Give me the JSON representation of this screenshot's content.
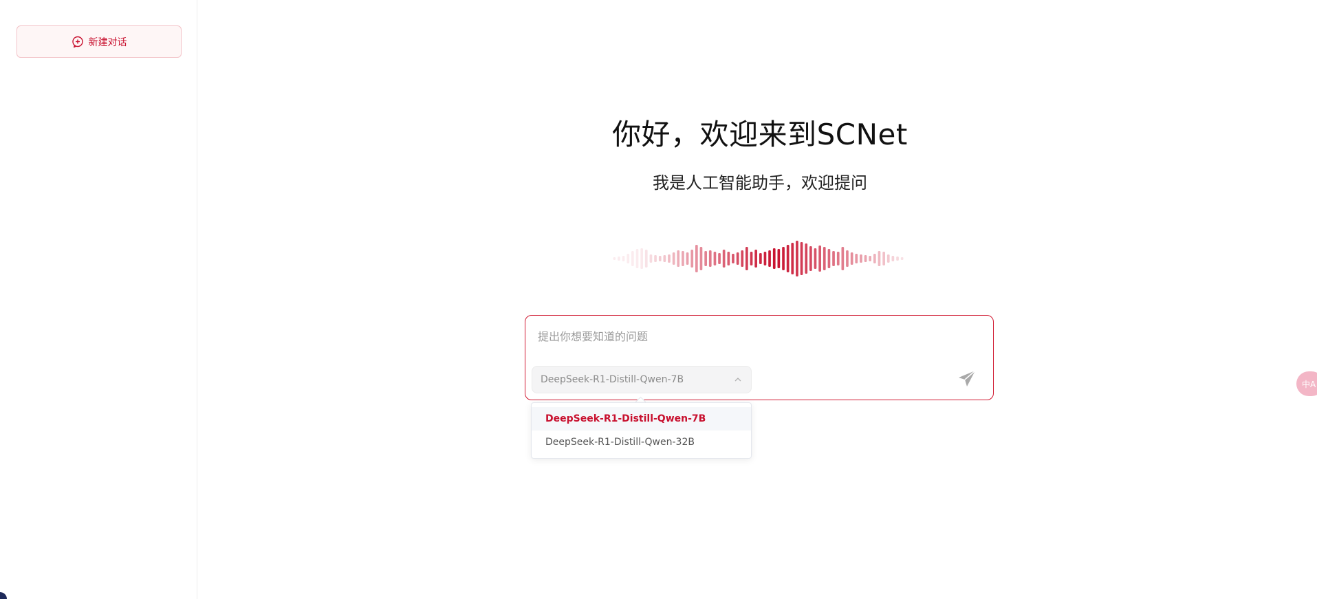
{
  "sidebar": {
    "new_chat_label": "新建对话"
  },
  "main": {
    "title": "你好，欢迎来到SCNet",
    "subtitle": "我是人工智能助手，欢迎提问"
  },
  "input": {
    "placeholder": "提出你想要知道的问题",
    "value": ""
  },
  "model_select": {
    "selected": "DeepSeek-R1-Distill-Qwen-7B",
    "options": [
      "DeepSeek-R1-Distill-Qwen-7B",
      "DeepSeek-R1-Distill-Qwen-32B"
    ]
  },
  "floating": {
    "translate_label": "中A"
  },
  "colors": {
    "accent": "#c8102e",
    "wave_light": "#f2c4cc"
  },
  "icons": {
    "new_chat": "chat-plus-icon",
    "send": "send-icon",
    "chevron": "chevron-up-icon",
    "translate": "translate-icon"
  }
}
